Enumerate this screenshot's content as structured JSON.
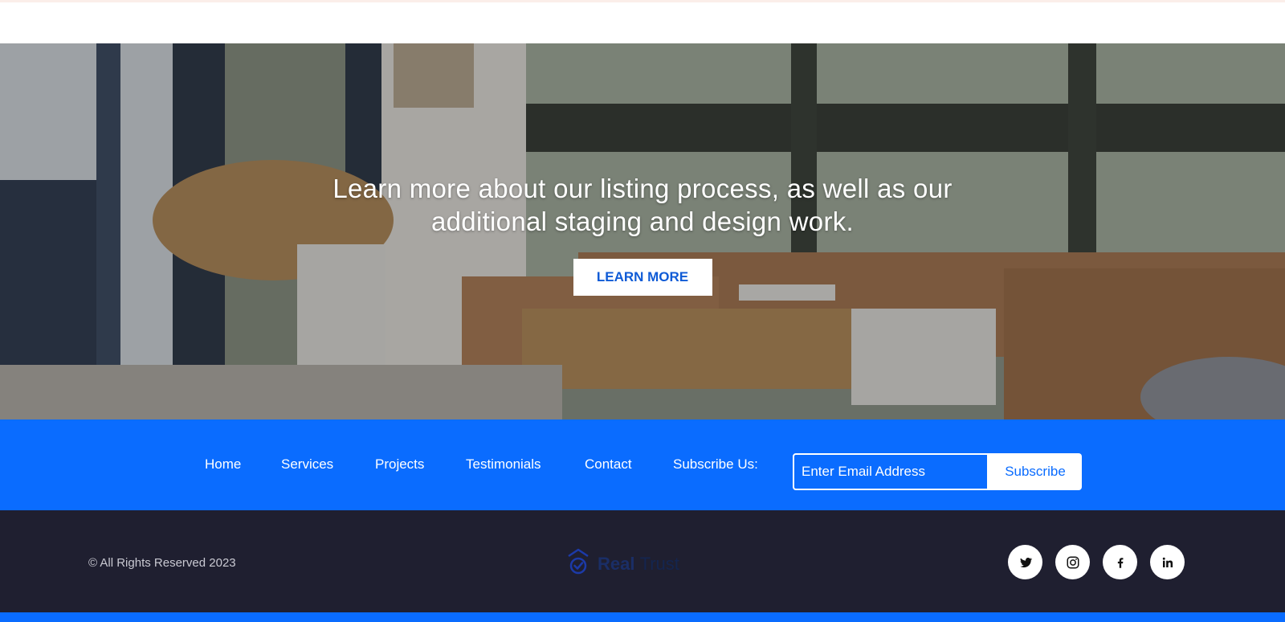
{
  "hero": {
    "heading": "Learn more about our listing process, as well as our additional staging and design work.",
    "button_label": "LEARN MORE"
  },
  "nav": {
    "links": [
      "Home",
      "Services",
      "Projects",
      "Testimonials",
      "Contact"
    ],
    "subscribe_label": "Subscribe Us:",
    "email_placeholder": "Enter Email Address",
    "subscribe_button": "Subscribe"
  },
  "footer": {
    "copyright": "© All Rights Reserved 2023",
    "logo_strong": "Real",
    "logo_light": "Trust",
    "social": [
      "twitter-icon",
      "instagram-icon",
      "facebook-icon",
      "linkedin-icon"
    ]
  },
  "colors": {
    "primary": "#0a6cff",
    "footer_bg": "#1f1f30",
    "button_text": "#0f5bd6"
  }
}
